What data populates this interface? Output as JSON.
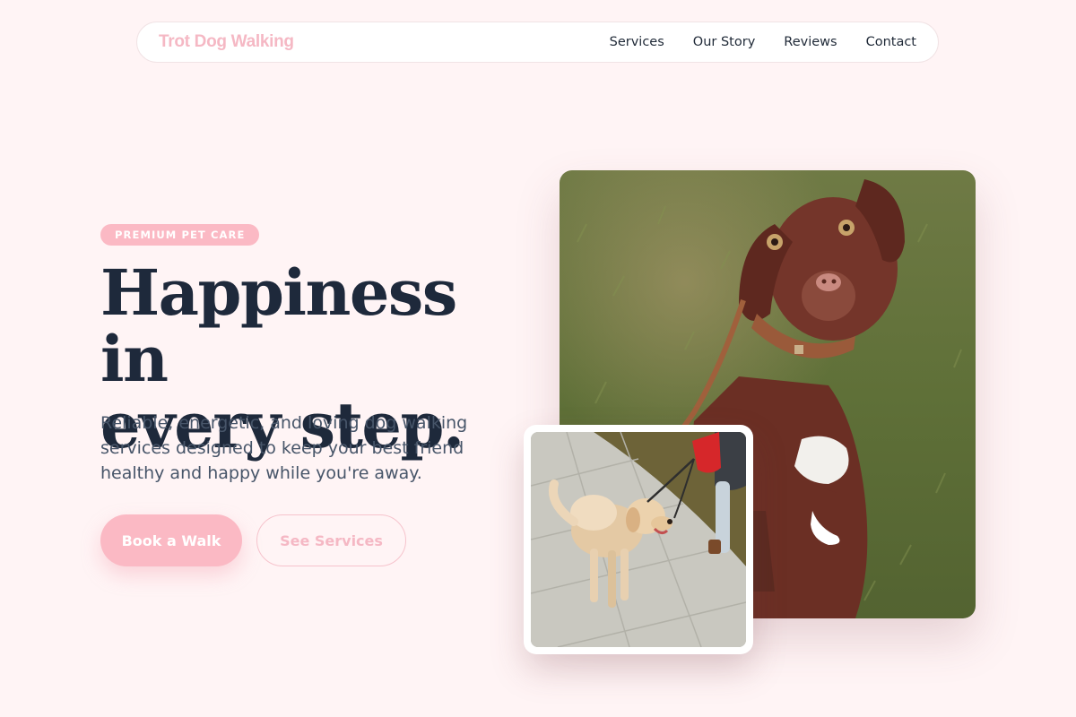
{
  "nav": {
    "brand": "Trot Dog Walking",
    "links": [
      "Services",
      "Our Story",
      "Reviews",
      "Contact"
    ]
  },
  "hero": {
    "badge": "PREMIUM PET CARE",
    "title_line1": "Happiness in",
    "title_line2": "every step.",
    "subtitle": "Reliable, energetic, and loving dog walking services designed to keep your best friend healthy and happy while you're away.",
    "primary_button": "Book a Walk",
    "secondary_button": "See Services"
  },
  "images": {
    "main": "brown-dog-sitting-on-grass",
    "small": "golden-retriever-walking-on-leash"
  },
  "colors": {
    "accent": "#fbb9c4",
    "background": "#fff4f5",
    "heading": "#1e293b",
    "body_text": "#475569"
  }
}
